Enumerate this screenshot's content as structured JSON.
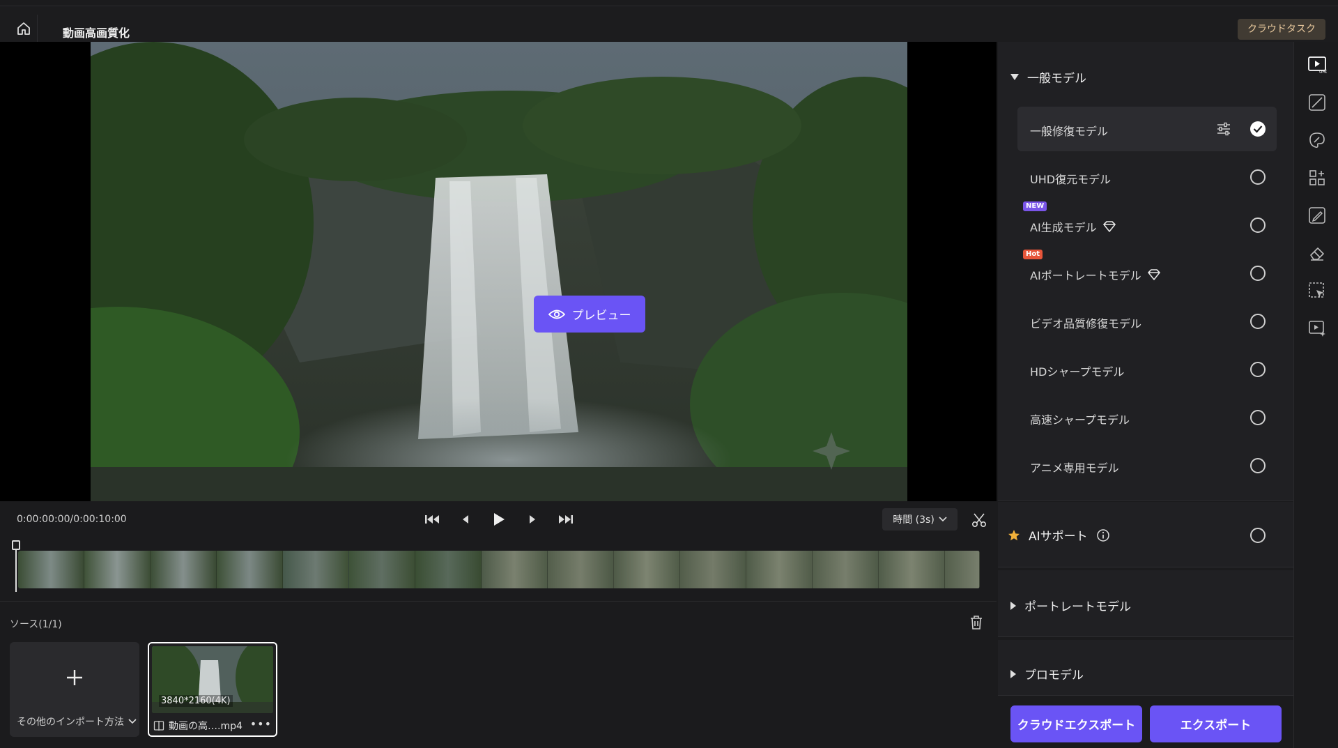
{
  "app": {
    "title": "動画高画質化",
    "cloud_task": "クラウドタスク"
  },
  "preview": {
    "button_label": "プレビュー"
  },
  "player": {
    "timecode": "0:00:00:00/0:00:10:00",
    "time_select": "時間 (3s)"
  },
  "source": {
    "title": "ソース(1/1)",
    "import_label": "その他のインポート方法",
    "file": {
      "resolution": "3840*2160(4K)",
      "name": "動画の高….mp4"
    }
  },
  "panel": {
    "general_title": "一般モデル",
    "models": [
      {
        "label": "一般修復モデル",
        "selected": true,
        "badge": ""
      },
      {
        "label": "UHD復元モデル",
        "selected": false,
        "badge": ""
      },
      {
        "label": "AI生成モデル",
        "selected": false,
        "badge": "NEW",
        "premium": true
      },
      {
        "label": "AIポートレートモデル",
        "selected": false,
        "badge": "Hot",
        "premium": true
      },
      {
        "label": "ビデオ品質修復モデル",
        "selected": false,
        "badge": ""
      },
      {
        "label": "HDシャープモデル",
        "selected": false,
        "badge": ""
      },
      {
        "label": "高速シャープモデル",
        "selected": false,
        "badge": ""
      },
      {
        "label": "アニメ専用モデル",
        "selected": false,
        "badge": ""
      }
    ],
    "ai_support": "AIサポート",
    "portrait_title": "ポートレートモデル",
    "pro_title": "プロモデル",
    "cloud_export": "クラウドエクスポート",
    "export": "エクスポート"
  },
  "side_tools": [
    "video-uhd-icon",
    "curve-icon",
    "color-icon",
    "add-grid-icon",
    "brush-edit-icon",
    "eraser-icon",
    "select-ai-icon",
    "video-sparkle-icon"
  ],
  "colors": {
    "accent": "#6a54f5",
    "panel_bg": "#202023",
    "app_bg": "#1b1b1d"
  }
}
